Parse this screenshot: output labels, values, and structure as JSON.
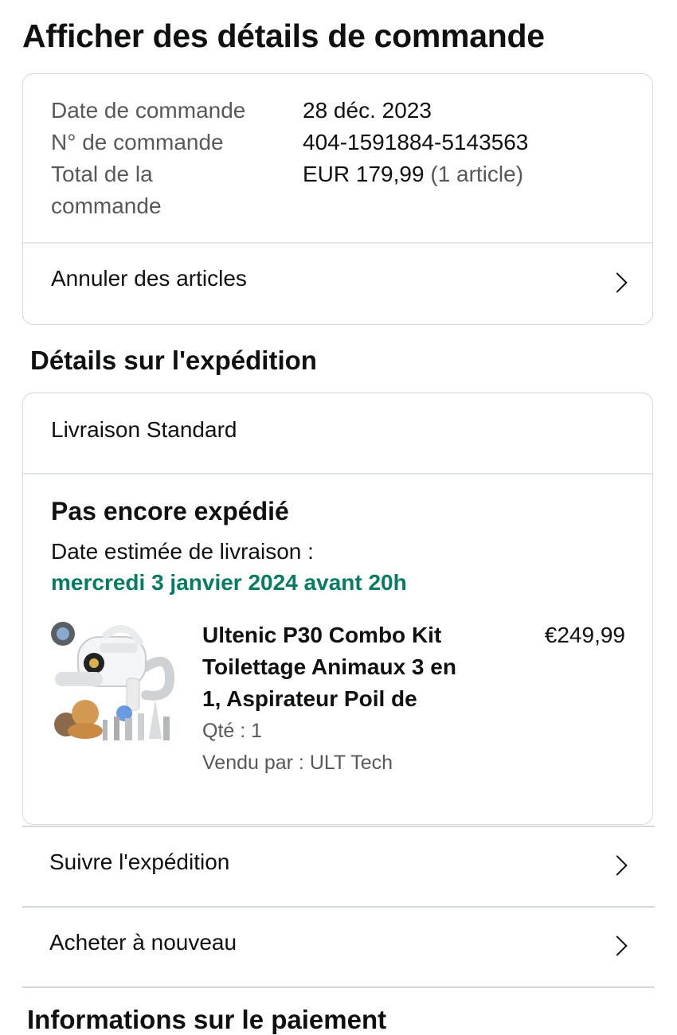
{
  "page": {
    "title": "Afficher des détails de commande"
  },
  "summary": {
    "order_date_label": "Date de commande",
    "order_date_value": "28 déc. 2023",
    "order_number_label": "N° de commande",
    "order_number_value": "404-1591884-5143563",
    "total_label_line1": "Total de la",
    "total_label_line2": "commande",
    "total_value": "EUR 179,99",
    "total_items": "(1 article)",
    "cancel_label": "Annuler des articles"
  },
  "shipping": {
    "section_title": "Détails sur l'expédition",
    "method": "Livraison Standard",
    "status": "Pas encore expédié",
    "estimate_label": "Date estimée de livraison :",
    "estimate_date": "mercredi 3 janvier 2024 avant 20h",
    "item": {
      "title_line1": "Ultenic P30 Combo Kit",
      "title_line2": "Toilettage Animaux 3 en",
      "title_line3": "1, Aspirateur Poil de",
      "price": "€249,99",
      "quantity": "Qté : 1",
      "seller": "Vendu par : ULT Tech"
    }
  },
  "actions": {
    "track_label": "Suivre l'expédition",
    "buy_again_label": "Acheter à nouveau"
  },
  "next_section": {
    "title_partial": "Informations sur le paiement"
  },
  "colors": {
    "accent_green": "#067d62",
    "border": "#d5d9d9",
    "muted_text": "#565959"
  },
  "icons": [
    "chevron-right-icon",
    "product-thumbnail"
  ]
}
